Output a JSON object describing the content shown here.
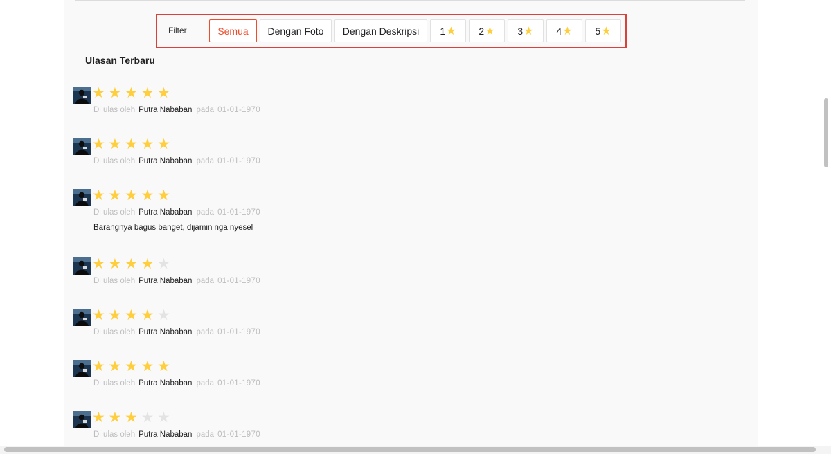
{
  "filter": {
    "label": "Filter",
    "buttons": [
      {
        "label": "Semua",
        "active": true
      },
      {
        "label": "Dengan Foto",
        "active": false
      },
      {
        "label": "Dengan Deskripsi",
        "active": false
      },
      {
        "label": "1",
        "icon": "star-icon",
        "active": false
      },
      {
        "label": "2",
        "icon": "star-icon",
        "active": false
      },
      {
        "label": "3",
        "icon": "star-icon",
        "active": false
      },
      {
        "label": "4",
        "icon": "star-icon",
        "active": false
      },
      {
        "label": "5",
        "icon": "star-icon",
        "active": false
      }
    ]
  },
  "section_title": "Ulasan Terbaru",
  "reviews": [
    {
      "rating": 5,
      "reviewed_by": "Di ulas oleh",
      "reviewer": "Putra Nababan",
      "at": "pada",
      "date": "01-01-1970",
      "comment": ""
    },
    {
      "rating": 5,
      "reviewed_by": "Di ulas oleh",
      "reviewer": "Putra Nababan",
      "at": "pada",
      "date": "01-01-1970",
      "comment": ""
    },
    {
      "rating": 5,
      "reviewed_by": "Di ulas oleh",
      "reviewer": "Putra Nababan",
      "at": "pada",
      "date": "01-01-1970",
      "comment": "Barangnya bagus banget, dijamin nga nyesel"
    },
    {
      "rating": 4,
      "reviewed_by": "Di ulas oleh",
      "reviewer": "Putra Nababan",
      "at": "pada",
      "date": "01-01-1970",
      "comment": ""
    },
    {
      "rating": 4,
      "reviewed_by": "Di ulas oleh",
      "reviewer": "Putra Nababan",
      "at": "pada",
      "date": "01-01-1970",
      "comment": ""
    },
    {
      "rating": 5,
      "reviewed_by": "Di ulas oleh",
      "reviewer": "Putra Nababan",
      "at": "pada",
      "date": "01-01-1970",
      "comment": ""
    },
    {
      "rating": 3,
      "reviewed_by": "Di ulas oleh",
      "reviewer": "Putra Nababan",
      "at": "pada",
      "date": "01-01-1970",
      "comment": ""
    }
  ],
  "colors": {
    "accent": "#ee4d2d",
    "highlight_border": "#d9423b",
    "star_on": "#ffce3d",
    "star_off": "#e3e3e3"
  }
}
